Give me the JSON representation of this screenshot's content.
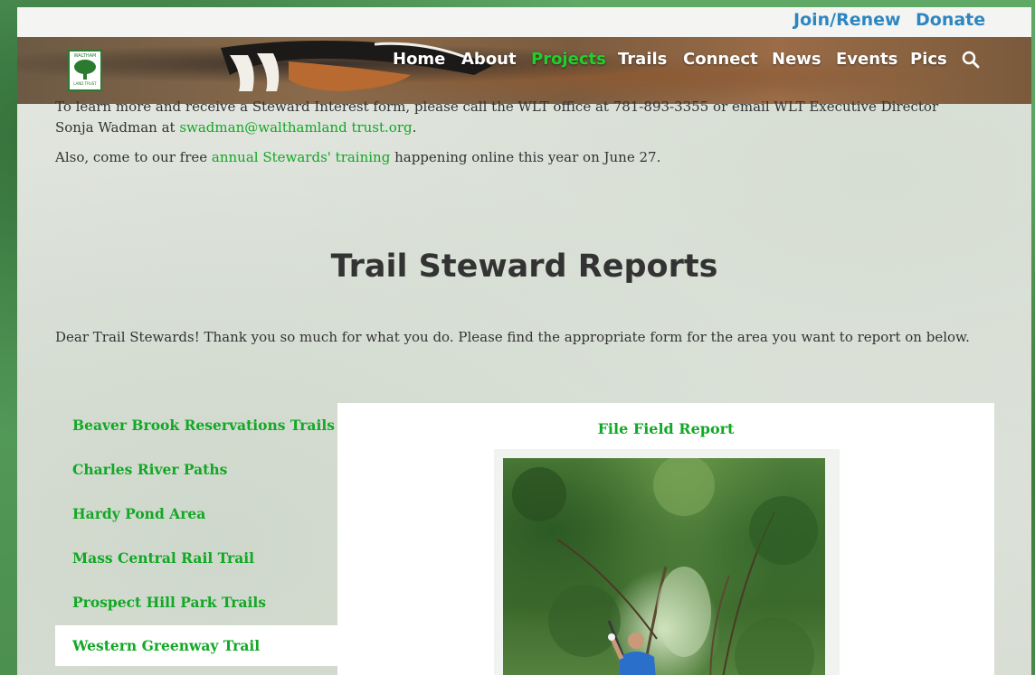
{
  "topbar": {
    "join_label": "Join/Renew",
    "donate_label": "Donate"
  },
  "logo": {
    "top_text": "WALTHAM",
    "bottom_text": "LAND TRUST"
  },
  "nav": {
    "items": [
      "Home",
      "About",
      "Projects",
      "Trails",
      "Connect",
      "News",
      "Events",
      "Pics"
    ],
    "active": "Projects",
    "search_icon": "search-icon"
  },
  "intro": {
    "line1": "To learn more and receive a Steward Interest form, please call the WLT office at 781-893-3355 or email WLT Executive Director",
    "line2_prefix": "Sonja Wadman at ",
    "email": "swadman@walthamland trust.org",
    "line2_suffix": ".",
    "line3_prefix": "Also, come to our free ",
    "training_link": "annual Stewards' training",
    "line3_suffix": " happening online this year on June 27."
  },
  "section": {
    "title": "Trail Steward Reports",
    "subtext": "Dear Trail Stewards! Thank you so much for what you do. Please find the appropriate form for the area you want to report on below."
  },
  "sidebar": {
    "items": [
      "Beaver Brook Reservations Trails",
      "Charles River Paths",
      "Hardy Pond Area",
      "Mass Central Rail Trail",
      "Prospect Hill Park Trails",
      "Western Greenway Trail"
    ],
    "active": "Western Greenway Trail"
  },
  "panel": {
    "title": "File Field Report"
  },
  "colors": {
    "link_green": "#12a825",
    "nav_active": "#1fd02a",
    "top_link_blue": "#2e86c1",
    "frame_green": "#4f9a56"
  }
}
